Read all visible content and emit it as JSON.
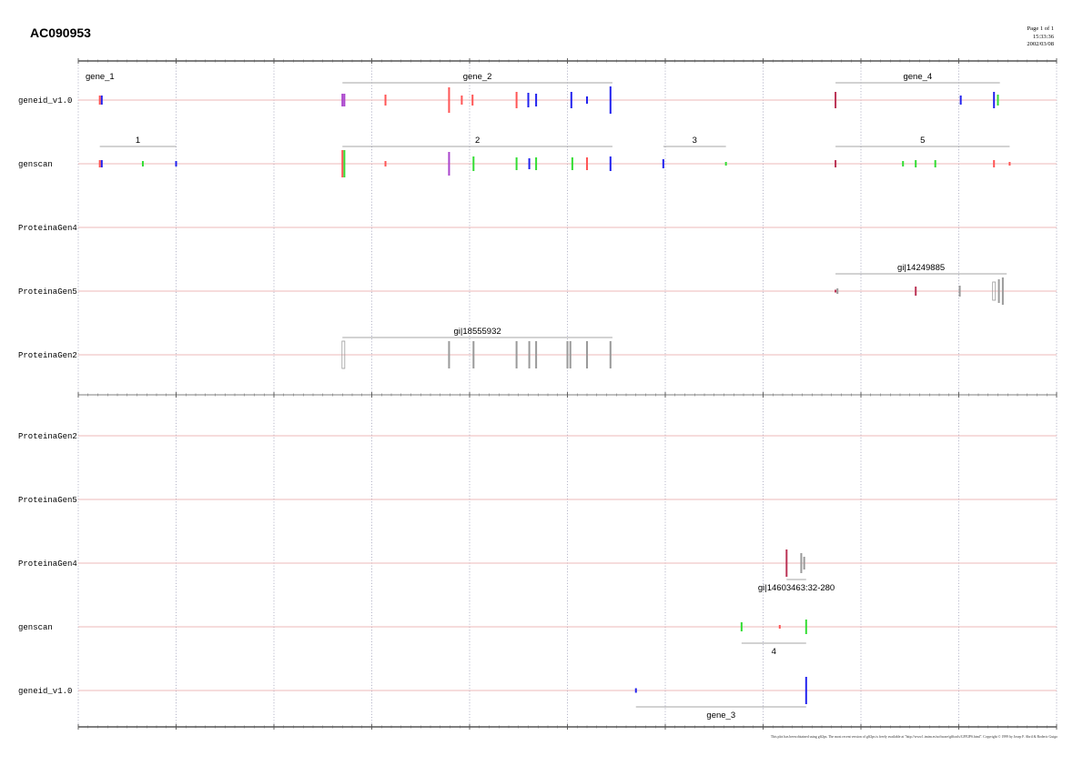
{
  "title": "AC090953",
  "page_info": [
    "Page 1 of 1",
    "15:33:36",
    "2002/03/08"
  ],
  "footer": "This plot has been obtained using gff2ps. The most recent version of gff2ps is freely available at \"http://www1.imim.es/software/gfftools/GFF2PS.html\". Copyright © 1999 by Josep F. Abril & Roderic Guigo",
  "colors": {
    "track_line": "#e8a0a0",
    "grid": "#8a8aa8",
    "axis": "#555555",
    "bracket": "#888888",
    "protein_match": "#9a9a9a",
    "exon_red": "#ff5555",
    "exon_blue": "#2222ee",
    "exon_green": "#33dd33",
    "exon_purple": "#aa44cc",
    "exon_darkred": "#bb3355"
  },
  "chart_data": {
    "type": "gene-structure",
    "sequence": "AC090953",
    "scale_length": 100000,
    "tick_major": 10000,
    "tick_minor": 1000,
    "strands": [
      {
        "strand": "+",
        "tracks": [
          {
            "name": "geneid_v1.0",
            "groups": [
              {
                "label": "gene_1",
                "start": 0,
                "end": 0,
                "bracket": false
              },
              {
                "label": "gene_2",
                "start": 27000,
                "end": 54600,
                "bracket": true
              },
              {
                "label": "gene_4",
                "start": 77400,
                "end": 94200,
                "bracket": true
              }
            ],
            "features": [
              {
                "pos": 2200,
                "h": 10,
                "color": "exon_red"
              },
              {
                "pos": 2400,
                "h": 10,
                "color": "exon_blue"
              },
              {
                "pos": 27000,
                "h": 14,
                "color": "exon_purple"
              },
              {
                "pos": 27200,
                "h": 14,
                "color": "exon_purple"
              },
              {
                "pos": 31400,
                "h": 12,
                "color": "exon_red"
              },
              {
                "pos": 37900,
                "h": 28,
                "color": "exon_red"
              },
              {
                "pos": 39200,
                "h": 10,
                "color": "exon_red"
              },
              {
                "pos": 40300,
                "h": 12,
                "color": "exon_red"
              },
              {
                "pos": 44800,
                "h": 18,
                "color": "exon_red"
              },
              {
                "pos": 46000,
                "h": 16,
                "color": "exon_blue"
              },
              {
                "pos": 46800,
                "h": 14,
                "color": "exon_blue"
              },
              {
                "pos": 50400,
                "h": 18,
                "color": "exon_blue"
              },
              {
                "pos": 52000,
                "h": 8,
                "color": "exon_blue"
              },
              {
                "pos": 54400,
                "h": 30,
                "color": "exon_blue"
              },
              {
                "pos": 77400,
                "h": 18,
                "color": "exon_darkred"
              },
              {
                "pos": 90200,
                "h": 10,
                "color": "exon_blue"
              },
              {
                "pos": 93600,
                "h": 18,
                "color": "exon_blue"
              },
              {
                "pos": 94000,
                "h": 12,
                "color": "exon_green"
              }
            ]
          },
          {
            "name": "genscan",
            "groups": [
              {
                "label": "1",
                "start": 2200,
                "end": 10000,
                "bracket": true
              },
              {
                "label": "2",
                "start": 27000,
                "end": 54600,
                "bracket": true
              },
              {
                "label": "3",
                "start": 59800,
                "end": 66200,
                "bracket": true
              },
              {
                "label": "5",
                "start": 77400,
                "end": 95200,
                "bracket": true
              }
            ],
            "features": [
              {
                "pos": 2200,
                "h": 8,
                "color": "exon_red"
              },
              {
                "pos": 2400,
                "h": 8,
                "color": "exon_blue"
              },
              {
                "pos": 6600,
                "h": 6,
                "color": "exon_green"
              },
              {
                "pos": 10000,
                "h": 6,
                "color": "exon_blue"
              },
              {
                "pos": 27000,
                "h": 30,
                "color": "exon_red"
              },
              {
                "pos": 27200,
                "h": 30,
                "color": "exon_green"
              },
              {
                "pos": 31400,
                "h": 6,
                "color": "exon_red"
              },
              {
                "pos": 37900,
                "h": 26,
                "color": "exon_purple"
              },
              {
                "pos": 40400,
                "h": 16,
                "color": "exon_green"
              },
              {
                "pos": 44800,
                "h": 14,
                "color": "exon_green"
              },
              {
                "pos": 46100,
                "h": 12,
                "color": "exon_blue"
              },
              {
                "pos": 46800,
                "h": 14,
                "color": "exon_green"
              },
              {
                "pos": 50500,
                "h": 14,
                "color": "exon_green"
              },
              {
                "pos": 52000,
                "h": 14,
                "color": "exon_red"
              },
              {
                "pos": 54400,
                "h": 16,
                "color": "exon_blue"
              },
              {
                "pos": 59800,
                "h": 10,
                "color": "exon_blue"
              },
              {
                "pos": 66200,
                "h": 4,
                "color": "exon_green"
              },
              {
                "pos": 77400,
                "h": 8,
                "color": "exon_darkred"
              },
              {
                "pos": 84300,
                "h": 6,
                "color": "exon_green"
              },
              {
                "pos": 85600,
                "h": 8,
                "color": "exon_green"
              },
              {
                "pos": 87600,
                "h": 8,
                "color": "exon_green"
              },
              {
                "pos": 93600,
                "h": 8,
                "color": "exon_red"
              },
              {
                "pos": 95200,
                "h": 4,
                "color": "exon_red"
              }
            ]
          },
          {
            "name": "ProteinaGen4",
            "groups": [],
            "features": []
          },
          {
            "name": "ProteinaGen5",
            "groups": [
              {
                "label": "gi|14249885",
                "start": 77400,
                "end": 94900,
                "bracket": true
              }
            ],
            "features": [
              {
                "pos": 77400,
                "h": 3,
                "color": "exon_darkred"
              },
              {
                "pos": 77600,
                "h": 6,
                "color": "protein_match"
              },
              {
                "pos": 85600,
                "h": 10,
                "color": "exon_darkred"
              },
              {
                "pos": 90100,
                "h": 12,
                "color": "protein_match"
              },
              {
                "pos": 93600,
                "h": 20,
                "color": "protein_match",
                "box": true
              },
              {
                "pos": 94100,
                "h": 26,
                "color": "protein_match"
              },
              {
                "pos": 94500,
                "h": 30,
                "color": "protein_match"
              }
            ]
          },
          {
            "name": "ProteinaGen2",
            "groups": [
              {
                "label": "gi|18555932",
                "start": 27000,
                "end": 54600,
                "bracket": true
              }
            ],
            "features": [
              {
                "pos": 27100,
                "h": 30,
                "color": "protein_match",
                "box": true
              },
              {
                "pos": 37900,
                "h": 30,
                "color": "protein_match"
              },
              {
                "pos": 40400,
                "h": 30,
                "color": "protein_match"
              },
              {
                "pos": 44800,
                "h": 30,
                "color": "protein_match"
              },
              {
                "pos": 46100,
                "h": 30,
                "color": "protein_match"
              },
              {
                "pos": 46800,
                "h": 30,
                "color": "protein_match"
              },
              {
                "pos": 50000,
                "h": 30,
                "color": "protein_match"
              },
              {
                "pos": 50300,
                "h": 30,
                "color": "protein_match"
              },
              {
                "pos": 52000,
                "h": 30,
                "color": "protein_match"
              },
              {
                "pos": 54400,
                "h": 30,
                "color": "protein_match"
              }
            ]
          }
        ]
      },
      {
        "strand": "-",
        "tracks": [
          {
            "name": "ProteinaGen2",
            "groups": [],
            "features": []
          },
          {
            "name": "ProteinaGen5",
            "groups": [],
            "features": []
          },
          {
            "name": "ProteinaGen4",
            "groups": [
              {
                "label": "gi|14603463:32-280",
                "start": 72400,
                "end": 74400,
                "bracket": true
              }
            ],
            "features": [
              {
                "pos": 72400,
                "h": 30,
                "color": "exon_darkred"
              },
              {
                "pos": 73900,
                "h": 22,
                "color": "protein_match"
              },
              {
                "pos": 74200,
                "h": 14,
                "color": "protein_match"
              }
            ]
          },
          {
            "name": "genscan",
            "groups": [
              {
                "label": "4",
                "start": 67800,
                "end": 74400,
                "bracket": true
              }
            ],
            "features": [
              {
                "pos": 67800,
                "h": 10,
                "color": "exon_green"
              },
              {
                "pos": 71700,
                "h": 4,
                "color": "exon_red"
              },
              {
                "pos": 74400,
                "h": 16,
                "color": "exon_green"
              }
            ]
          },
          {
            "name": "geneid_v1.0",
            "groups": [
              {
                "label": "gene_3",
                "start": 57000,
                "end": 74400,
                "bracket": true
              }
            ],
            "features": [
              {
                "pos": 57000,
                "h": 5,
                "color": "exon_blue"
              },
              {
                "pos": 74400,
                "h": 30,
                "color": "exon_blue"
              }
            ]
          }
        ]
      }
    ]
  }
}
